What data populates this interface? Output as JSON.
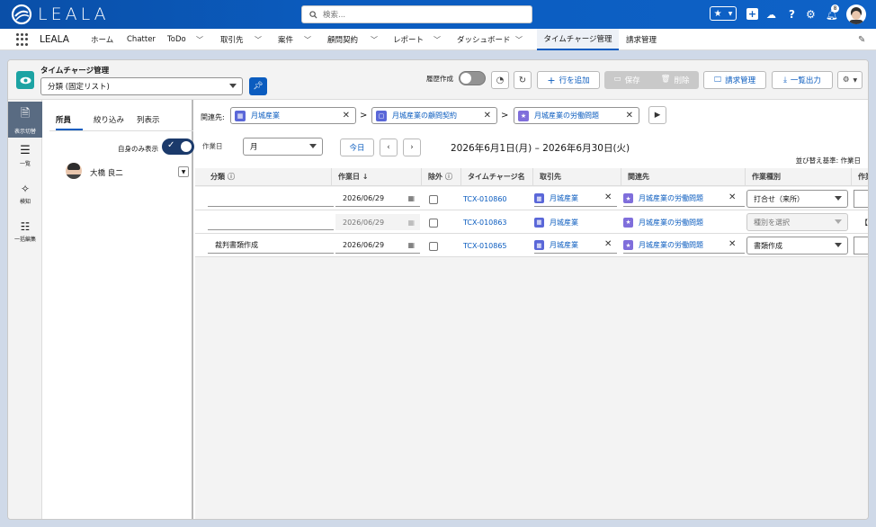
{
  "brand": {
    "name": "LEALA",
    "primary": "#0b5cbf"
  },
  "header": {
    "search_placeholder": "検索...",
    "notification_count": "8"
  },
  "nav": {
    "app_name": "LEALA",
    "items": [
      {
        "label": "ホーム"
      },
      {
        "label": "Chatter"
      },
      {
        "label": "ToDo"
      },
      {
        "label": "取引先"
      },
      {
        "label": "案件"
      },
      {
        "label": "顧問契約"
      },
      {
        "label": "レポート"
      },
      {
        "label": "ダッシュボード"
      },
      {
        "label": "タイムチャージ管理"
      },
      {
        "label": "請求管理"
      }
    ]
  },
  "page": {
    "title": "タイムチャージ管理",
    "view_select": "分類 (固定リスト)",
    "history_label": "履歴作成",
    "add_row": "行を追加",
    "save": "保存",
    "delete": "削除",
    "billing": "請求管理",
    "export": "一覧出力"
  },
  "rail": {
    "items": [
      "表示切替",
      "一覧",
      "検知",
      "一括編集"
    ]
  },
  "side": {
    "tabs": [
      "所員",
      "絞り込み",
      "列表示"
    ],
    "self_only_label": "自身のみ表示",
    "member": "大橋 良二"
  },
  "related": {
    "label": "関連先:",
    "account": "月城産業",
    "contract": "月城産業の顧問契約",
    "matter": "月城産業の労働問題"
  },
  "filter": {
    "date_label": "作業日",
    "period": "月",
    "today": "今日",
    "range": "2026年6月1日(月) – 2026年6月30日(火)",
    "sort": "並び替え基準: 作業日"
  },
  "table": {
    "headers": [
      "分類",
      "作業日 ↓",
      "除外",
      "タイムチャージ名",
      "取引先",
      "関連先",
      "作業種別",
      "作業"
    ],
    "rows": [
      {
        "category": "",
        "date": "2026/06/29",
        "name": "TCX-010860",
        "account": "月城産業",
        "related": "月城産業の労働問題",
        "type": "打合せ（来所）",
        "extra": ""
      },
      {
        "category": "",
        "date": "2026/06/29",
        "name": "TCX-010863",
        "account": "月城産業",
        "related": "月城産業の労働問題",
        "type": "種別を選択",
        "extra": "【直"
      },
      {
        "category": "裁判書類作成",
        "date": "2026/06/29",
        "name": "TCX-010865",
        "account": "月城産業",
        "related": "月城産業の労働問題",
        "type": "書類作成",
        "extra": ""
      }
    ]
  }
}
